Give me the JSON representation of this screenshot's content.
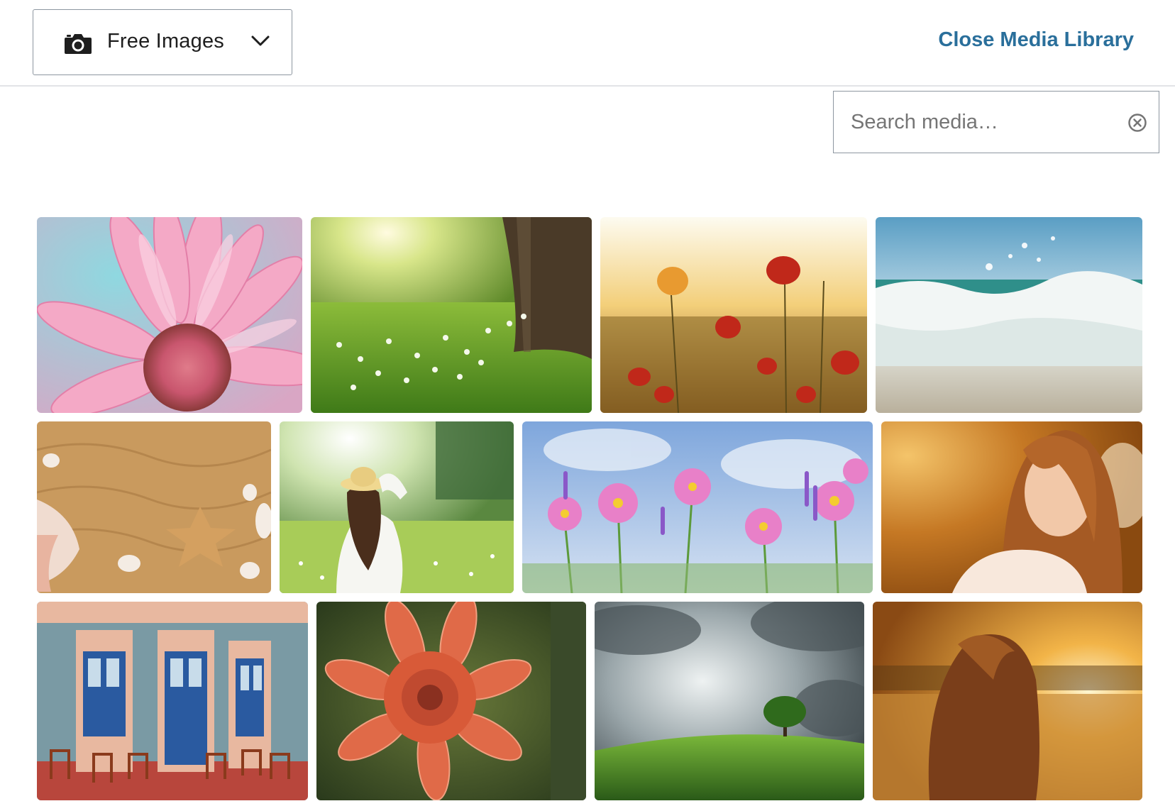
{
  "header": {
    "source_label": "Free Images",
    "close_label": "Close Media Library",
    "accent_color": "#2a6f9b"
  },
  "search": {
    "placeholder": "Search media…"
  },
  "icons": {
    "source": "camera-icon",
    "dropdown": "chevron-down-icon",
    "clear": "clear-circle-x-icon"
  }
}
